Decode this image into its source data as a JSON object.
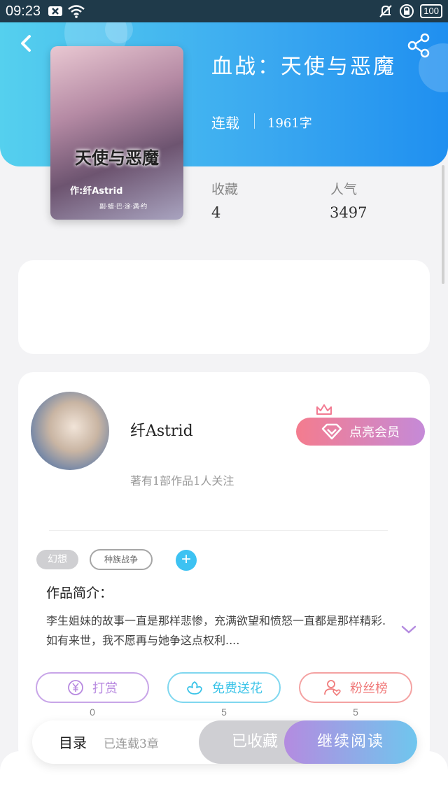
{
  "status_bar": {
    "time": "09:23",
    "battery": "100",
    "icons": [
      "close-box-icon",
      "wifi-icon",
      "bell-off-icon",
      "lock-rotation-icon"
    ]
  },
  "header": {
    "back_icon": "chevron-left-icon",
    "share_icon": "share-icon",
    "title": "血战：天使与恶魔",
    "status": "连载",
    "words": "1961字"
  },
  "cover": {
    "title": "天使与恶魔",
    "author": "作:纤Astrid",
    "sub": "副·蜡·巴·涂·满·约"
  },
  "stats": {
    "favorites_label": "收藏",
    "favorites_value": "4",
    "popularity_label": "人气",
    "popularity_value": "3497"
  },
  "author": {
    "name": "纤Astrid",
    "info": "著有1部作品1人关注",
    "vip_label": "点亮会员"
  },
  "tags": [
    "幻想",
    "种族战争"
  ],
  "intro": {
    "label": "作品简介：",
    "text": "李生姐妹的故事一直是那样悲惨，充满欲望和愤怒一直都是那样精彩.如有来世，我不愿再与她争这点权利...."
  },
  "actions": [
    {
      "label": "打赏",
      "count": "0",
      "color": "#b88ae0",
      "icon": "yen-coin-icon"
    },
    {
      "label": "免费送花",
      "count": "5",
      "color": "#3cc4e8",
      "icon": "flower-icon"
    },
    {
      "label": "粉丝榜",
      "count": "5",
      "color": "#f07a7a",
      "icon": "fan-user-icon"
    }
  ],
  "bottom_bar": {
    "toc_label": "目录",
    "toc_sub": "已连载3章",
    "favorited_label": "已收藏",
    "read_label": "继续阅读"
  }
}
